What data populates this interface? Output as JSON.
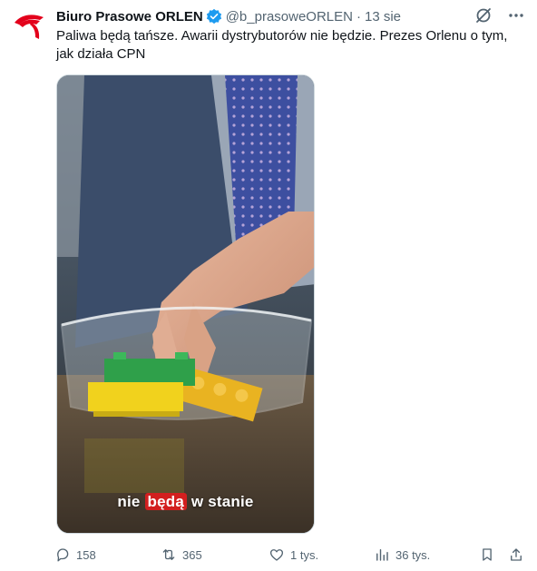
{
  "account": {
    "name": "Biuro Prasowe ORLEN",
    "handle": "@b_prasoweORLEN",
    "separator": "·",
    "date": "13 sie"
  },
  "tweet": {
    "text": "Paliwa będą tańsze. Awarii dystrybutorów nie będzie. Prezes Orlenu o tym, jak działa CPN"
  },
  "video": {
    "caption_before": "nie ",
    "caption_highlight": "będą",
    "caption_after": " w stanie"
  },
  "metrics": {
    "replies": "158",
    "reposts": "365",
    "likes": "1 tys.",
    "views": "36 tys."
  },
  "colors": {
    "brand_red": "#e3001b",
    "verified_blue": "#1d9bf0",
    "muted_text": "#536471",
    "caption_highlight": "#d21f1f"
  },
  "icons": [
    "orlen-eagle-logo",
    "verified-badge-icon",
    "grok-icon",
    "more-icon",
    "reply-icon",
    "repost-icon",
    "like-icon",
    "views-icon",
    "bookmark-icon",
    "share-icon"
  ]
}
